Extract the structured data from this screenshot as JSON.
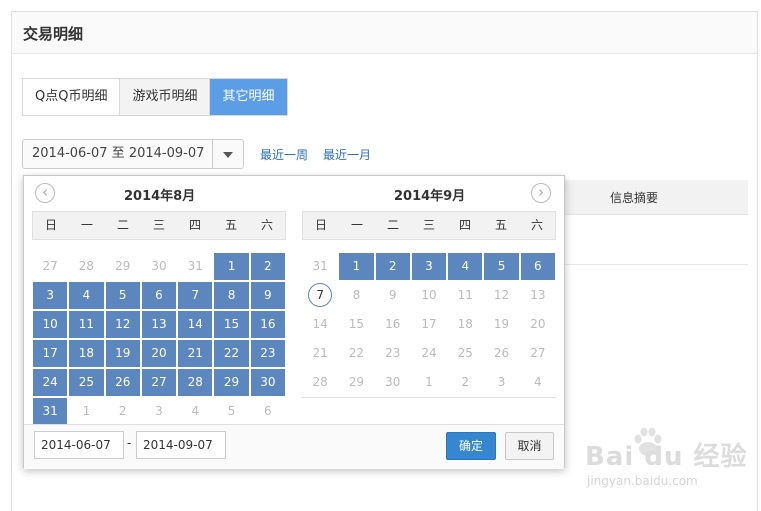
{
  "panel": {
    "title": "交易明细"
  },
  "tabs": [
    {
      "label": "Q点Q币明细",
      "active": false
    },
    {
      "label": "游戏币明细",
      "active": false
    },
    {
      "label": "其它明细",
      "active": true
    }
  ],
  "filter": {
    "range_text": "2014-06-07 至 2014-09-07",
    "quick_week": "最近一周",
    "quick_month": "最近一月"
  },
  "table": {
    "column_summary": "信息摘要"
  },
  "datepicker": {
    "weekdays": [
      "日",
      "一",
      "二",
      "三",
      "四",
      "五",
      "六"
    ],
    "left": {
      "title": "2014年8月",
      "days": [
        {
          "d": "27",
          "s": "other"
        },
        {
          "d": "28",
          "s": "other"
        },
        {
          "d": "29",
          "s": "other"
        },
        {
          "d": "30",
          "s": "other"
        },
        {
          "d": "31",
          "s": "other"
        },
        {
          "d": "1",
          "s": "sel"
        },
        {
          "d": "2",
          "s": "sel"
        },
        {
          "d": "3",
          "s": "sel"
        },
        {
          "d": "4",
          "s": "sel"
        },
        {
          "d": "5",
          "s": "sel"
        },
        {
          "d": "6",
          "s": "sel"
        },
        {
          "d": "7",
          "s": "sel"
        },
        {
          "d": "8",
          "s": "sel"
        },
        {
          "d": "9",
          "s": "sel"
        },
        {
          "d": "10",
          "s": "sel"
        },
        {
          "d": "11",
          "s": "sel"
        },
        {
          "d": "12",
          "s": "sel"
        },
        {
          "d": "13",
          "s": "sel"
        },
        {
          "d": "14",
          "s": "sel"
        },
        {
          "d": "15",
          "s": "sel"
        },
        {
          "d": "16",
          "s": "sel"
        },
        {
          "d": "17",
          "s": "sel"
        },
        {
          "d": "18",
          "s": "sel"
        },
        {
          "d": "19",
          "s": "sel"
        },
        {
          "d": "20",
          "s": "sel"
        },
        {
          "d": "21",
          "s": "sel"
        },
        {
          "d": "22",
          "s": "sel"
        },
        {
          "d": "23",
          "s": "sel"
        },
        {
          "d": "24",
          "s": "sel"
        },
        {
          "d": "25",
          "s": "sel"
        },
        {
          "d": "26",
          "s": "sel"
        },
        {
          "d": "27",
          "s": "sel"
        },
        {
          "d": "28",
          "s": "sel"
        },
        {
          "d": "29",
          "s": "sel"
        },
        {
          "d": "30",
          "s": "sel"
        },
        {
          "d": "31",
          "s": "sel"
        },
        {
          "d": "1",
          "s": "other"
        },
        {
          "d": "2",
          "s": "other"
        },
        {
          "d": "3",
          "s": "other"
        },
        {
          "d": "4",
          "s": "other"
        },
        {
          "d": "5",
          "s": "other"
        },
        {
          "d": "6",
          "s": "other"
        }
      ]
    },
    "right": {
      "title": "2014年9月",
      "days": [
        {
          "d": "31",
          "s": "other"
        },
        {
          "d": "1",
          "s": "sel"
        },
        {
          "d": "2",
          "s": "sel"
        },
        {
          "d": "3",
          "s": "sel"
        },
        {
          "d": "4",
          "s": "sel"
        },
        {
          "d": "5",
          "s": "sel"
        },
        {
          "d": "6",
          "s": "sel"
        },
        {
          "d": "7",
          "s": "today"
        },
        {
          "d": "8",
          "s": "other"
        },
        {
          "d": "9",
          "s": "other"
        },
        {
          "d": "10",
          "s": "other"
        },
        {
          "d": "11",
          "s": "other"
        },
        {
          "d": "12",
          "s": "other"
        },
        {
          "d": "13",
          "s": "other"
        },
        {
          "d": "14",
          "s": "other"
        },
        {
          "d": "15",
          "s": "other"
        },
        {
          "d": "16",
          "s": "other"
        },
        {
          "d": "17",
          "s": "other"
        },
        {
          "d": "18",
          "s": "other"
        },
        {
          "d": "19",
          "s": "other"
        },
        {
          "d": "20",
          "s": "other"
        },
        {
          "d": "21",
          "s": "other"
        },
        {
          "d": "22",
          "s": "other"
        },
        {
          "d": "23",
          "s": "other"
        },
        {
          "d": "24",
          "s": "other"
        },
        {
          "d": "25",
          "s": "other"
        },
        {
          "d": "26",
          "s": "other"
        },
        {
          "d": "27",
          "s": "other"
        },
        {
          "d": "28",
          "s": "other"
        },
        {
          "d": "29",
          "s": "other"
        },
        {
          "d": "30",
          "s": "other"
        },
        {
          "d": "1",
          "s": "other"
        },
        {
          "d": "2",
          "s": "other"
        },
        {
          "d": "3",
          "s": "other"
        },
        {
          "d": "4",
          "s": "other"
        }
      ]
    },
    "start_input": "2014-06-07",
    "end_input": "2014-09-07",
    "dash": "-",
    "confirm_label": "确定",
    "cancel_label": "取消",
    "prev_icon": "chevron-left-icon",
    "next_icon": "chevron-right-icon"
  },
  "watermark": {
    "brand": "Bai du 经验",
    "url": "jingyan.baidu.com"
  },
  "colors": {
    "accent": "#5b9ee6",
    "selected_day": "#5b86be",
    "confirm": "#3587d0",
    "link": "#2d6fb8"
  }
}
